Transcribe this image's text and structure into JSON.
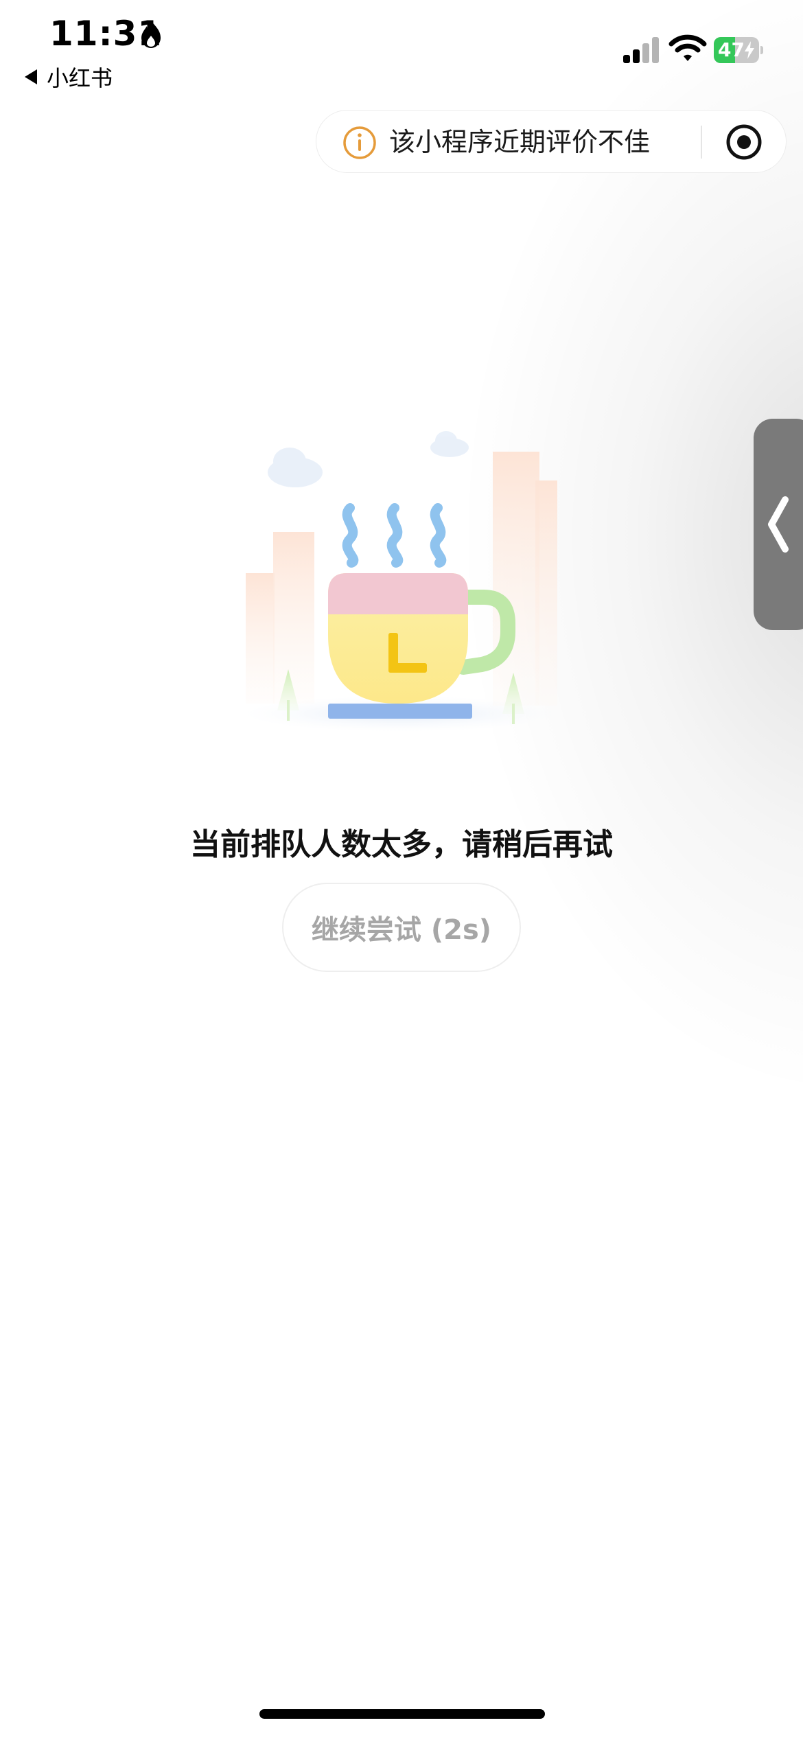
{
  "status_bar": {
    "time": "11:31",
    "back_app_label": "小红书",
    "battery_level": "47",
    "battery_percent": 47
  },
  "capsule": {
    "warning_text": "该小程序近期评价不佳"
  },
  "icons": {
    "flame": "flame-icon",
    "signal": "cellular-signal-icon",
    "wifi": "wifi-icon",
    "battery": "battery-icon",
    "info": "info-icon",
    "record": "record-icon",
    "chevron": "chevron-left-icon"
  },
  "main": {
    "message": "当前排队人数太多，请稍后再试",
    "retry_button": "继续尝试 (2s)"
  },
  "colors": {
    "info_orange": "#e59b3a",
    "battery_green": "#34c759",
    "side_handle": "#7a7a7a",
    "button_text": "#a6a6a6"
  }
}
